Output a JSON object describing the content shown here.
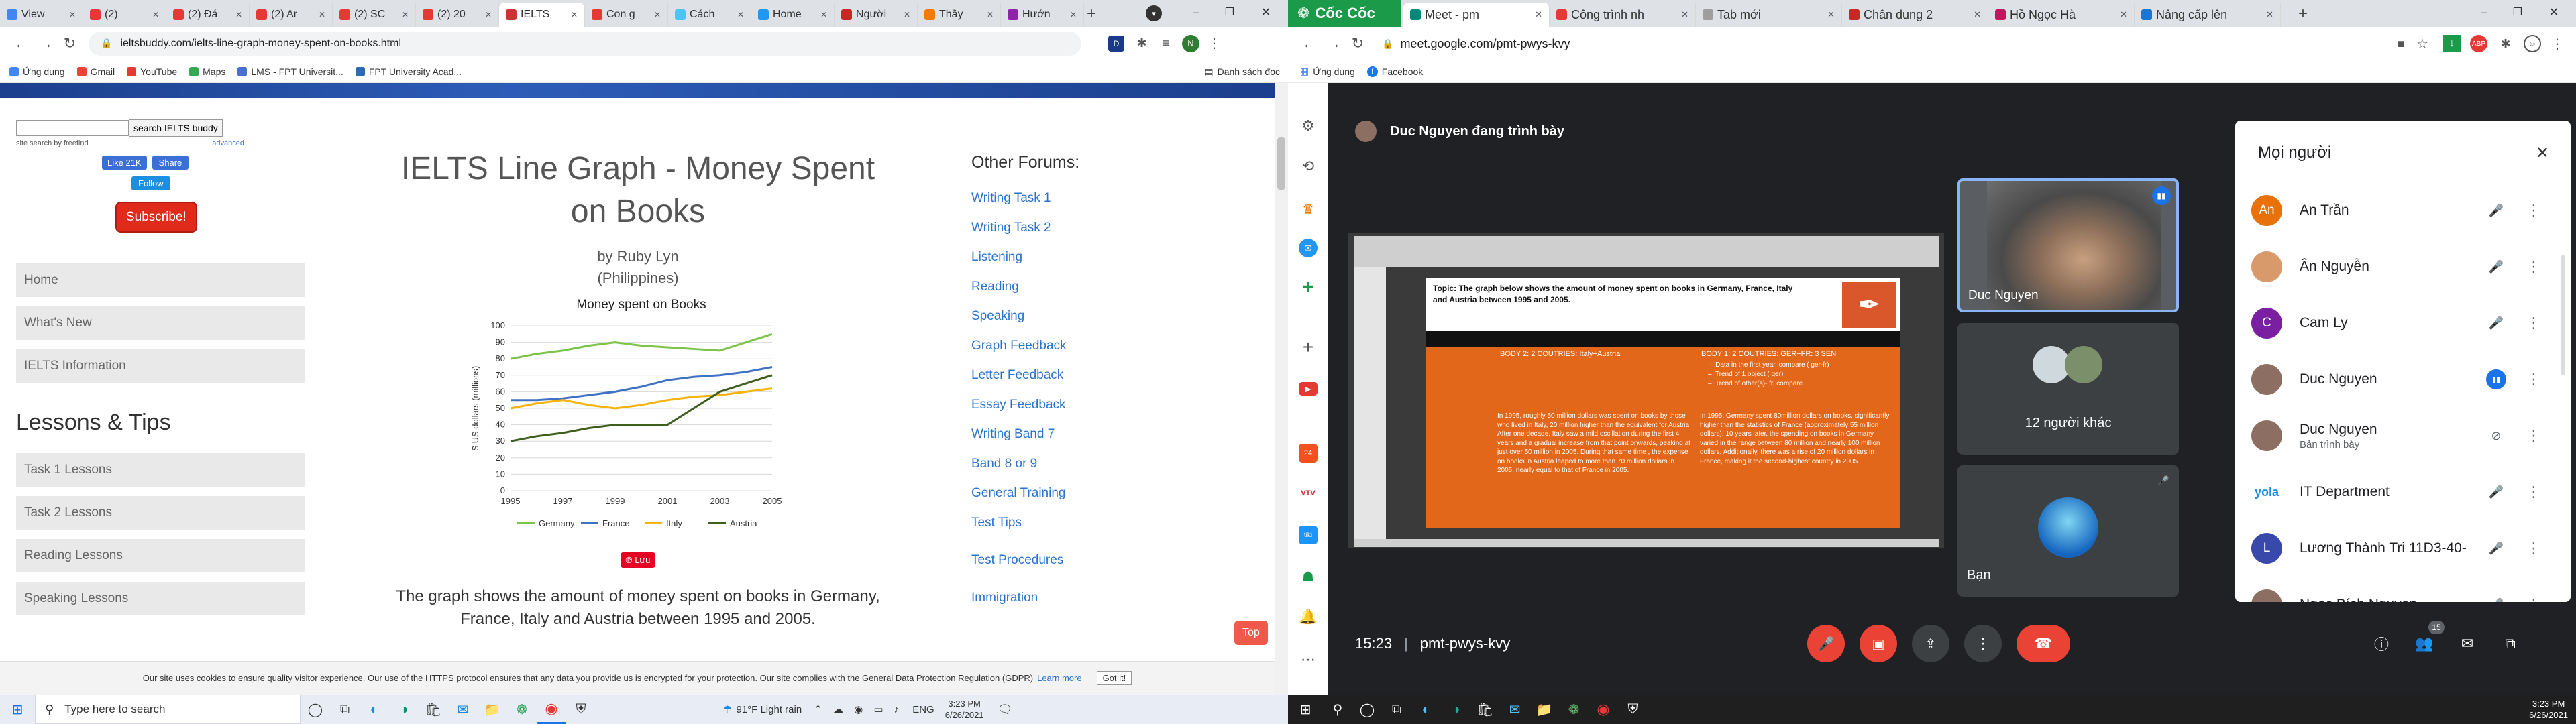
{
  "left": {
    "tabs": [
      {
        "label": "View",
        "color": "#4285f4"
      },
      {
        "label": "(2)",
        "color": "#e53935"
      },
      {
        "label": "(2) Đá",
        "color": "#e53935"
      },
      {
        "label": "(2) Ar",
        "color": "#e53935"
      },
      {
        "label": "(2) SC",
        "color": "#e53935"
      },
      {
        "label": "(2) 20",
        "color": "#e53935"
      },
      {
        "label": "IELTS",
        "color": "#cc3333",
        "active": true
      },
      {
        "label": "Con g",
        "color": "#e53935"
      },
      {
        "label": "Cách",
        "color": "#4fc3f7"
      },
      {
        "label": "Home",
        "color": "#2196f3"
      },
      {
        "label": "Người",
        "color": "#c62828"
      },
      {
        "label": "Thầy",
        "color": "#f57c00"
      },
      {
        "label": "Hướn",
        "color": "#8e24aa"
      }
    ],
    "url": "ieltsbuddy.com/ielts-line-graph-money-spent-on-books.html",
    "bookmarks": [
      "Ứng dụng",
      "Gmail",
      "YouTube",
      "Maps",
      "LMS - FPT Universit...",
      "FPT University Acad..."
    ],
    "reading_list": "Danh sách đọc",
    "page": {
      "search_button": "search IELTS buddy",
      "site_search": "site search by freefind",
      "advanced": "advanced",
      "like": "Like 21K",
      "share": "Share",
      "follow": "Follow",
      "subscribe": "Subscribe!",
      "nav": [
        "Home",
        "What's New",
        "IELTS Information"
      ],
      "lessons_heading": "Lessons & Tips",
      "lessons": [
        "Task 1 Lessons",
        "Task 2 Lessons",
        "Reading Lessons",
        "Speaking Lessons"
      ],
      "title": "IELTS Line Graph - Money Spent on Books",
      "author": "by Ruby Lyn",
      "country": "(Philippines)",
      "save": "Lưu",
      "paragraph": "The graph shows the amount of money spent on books in Germany, France, Italy and Austria between 1995 and 2005.",
      "forums_heading": "Other Forums:",
      "forums": [
        "Writing Task 1",
        "Writing Task 2",
        "Listening",
        "Reading",
        "Speaking",
        "Graph Feedback",
        "Letter Feedback",
        "Essay Feedback",
        "Writing Band 7",
        "Band 8 or 9",
        "General Training",
        "Test Tips",
        "Test Procedures",
        "Immigration"
      ],
      "top": "Top",
      "cookie": "Our site uses cookies to ensure quality visitor experience. Our use of the HTTPS protocol ensures that any data you provide us is encrypted for your protection. Our site complies with the General Data Protection Regulation (GDPR)",
      "learn_more": "Learn more",
      "got_it": "Got it!"
    }
  },
  "chart_data": {
    "type": "line",
    "title": "Money spent on Books",
    "ylabel": "$ US dollars (millions)",
    "xlabel": "",
    "x": [
      1995,
      1996,
      1997,
      1998,
      1999,
      2000,
      2001,
      2002,
      2003,
      2004,
      2005
    ],
    "xticks": [
      "1995",
      "1997",
      "1999",
      "2001",
      "2003",
      "2005"
    ],
    "yticks": [
      "0",
      "10",
      "20",
      "30",
      "40",
      "50",
      "60",
      "70",
      "80",
      "90",
      "100"
    ],
    "ylim": [
      0,
      100
    ],
    "series": [
      {
        "name": "Germany",
        "color": "#7cc34a",
        "values": [
          80,
          83,
          85,
          88,
          90,
          88,
          87,
          86,
          85,
          90,
          95
        ]
      },
      {
        "name": "France",
        "color": "#3f72c4",
        "values": [
          55,
          55,
          56,
          58,
          60,
          63,
          67,
          69,
          70,
          72,
          75
        ]
      },
      {
        "name": "Italy",
        "color": "#f5b30e",
        "values": [
          50,
          53,
          55,
          52,
          50,
          52,
          55,
          57,
          58,
          60,
          62
        ]
      },
      {
        "name": "Austria",
        "color": "#3f5f1f",
        "values": [
          30,
          33,
          35,
          38,
          40,
          40,
          40,
          50,
          60,
          65,
          70
        ]
      }
    ]
  },
  "right": {
    "browser_name": "Cốc Cốc",
    "tabs": [
      {
        "label": "Meet - pm",
        "color": "#00897b",
        "active": true
      },
      {
        "label": "Công trình nh",
        "color": "#e53935"
      },
      {
        "label": "Tab mới",
        "color": "#9e9e9e"
      },
      {
        "label": "Chân dung 2",
        "color": "#c62828"
      },
      {
        "label": "Hồ Ngọc Hà",
        "color": "#c2185b"
      },
      {
        "label": "Nâng cấp lên",
        "color": "#1976d2"
      }
    ],
    "url": "meet.google.com/pmt-pwys-kvy",
    "bookmarks": [
      "Ứng dụng",
      "Facebook"
    ],
    "presenter": "Duc Nguyen đang trình bày",
    "slide": {
      "topic": "Topic: The graph below shows the amount of money spent on books in Germany, France, Italy and Austria between 1995 and 2005.",
      "body2_title": "BODY 2: 2 COUTRIES: Italy+Austria",
      "body1_title": "BODY 1: 2 COUTRIES: GER+FR: 3 SEN",
      "bullets": [
        "Data in the first year, compare ( ger-fr)",
        "Trend of 1 object ( ger)",
        "Trend of other(s)- fr, compare"
      ],
      "left_text": "In 1995, roughly 50 million dollars was spent on books by those who lived in Italy, 20 million higher than the equivalent for Austria. After one decade, Italy saw a mild oscillation during the first 4 years and a gradual increase from that point onwards, peaking at just over 50 million in 2005. During that same time , the expense on books in Austria leaped to more than 70 million dollars in 2005, nearly equal to that of France in 2005.",
      "right_text": "In 1995, Germany spent 80million dollars on books, significantly higher than the statistics of France (approximately 55 million dollars). 10 years later, the spending on books in Germany varied in the range between 80 million and nearly 100 million dollars. Additionally, there was a rise of 20 million dollars in France, making it the second-highest country in 2005."
    },
    "tile_main": "Duc Nguyen",
    "tile_others": "12 người khác",
    "tile_you": "Bạn",
    "time": "15:23",
    "meeting_code": "pmt-pwys-kvy",
    "people_badge": "15",
    "panel_title": "Mọi người",
    "people": [
      {
        "initials": "An",
        "name": "An Trần",
        "color": "#e8710a",
        "sub": ""
      },
      {
        "initials": "",
        "name": "Ân Nguyễn",
        "color": "#d89a6a",
        "sub": ""
      },
      {
        "initials": "C",
        "name": "Cam Ly",
        "color": "#7b1fa2",
        "sub": ""
      },
      {
        "initials": "",
        "name": "Duc Nguyen",
        "color": "#8d6e63",
        "sub": ""
      },
      {
        "initials": "",
        "name": "Duc Nguyen",
        "color": "#8d6e63",
        "sub": "Bản trình bày"
      },
      {
        "initials": "yola",
        "name": "IT Department",
        "color": "#ffffff",
        "sub": ""
      },
      {
        "initials": "L",
        "name": "Lương Thành Tri 11D3-40-",
        "color": "#3949ab",
        "sub": ""
      },
      {
        "initials": "",
        "name": "Ngọc Bích Nguyen",
        "color": "#8d6e63",
        "sub": ""
      }
    ]
  },
  "taskbar_left": {
    "search_placeholder": "Type here to search",
    "weather": "91°F  Light rain",
    "lang": "ENG",
    "time": "3:23 PM",
    "date": "6/26/2021"
  },
  "taskbar_right": {
    "time": "3:23 PM",
    "date": "6/26/2021"
  }
}
